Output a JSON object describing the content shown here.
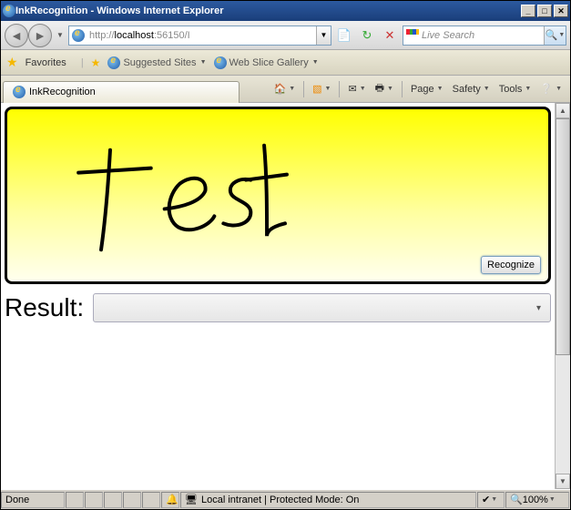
{
  "window": {
    "title": "InkRecognition - Windows Internet Explorer"
  },
  "address": {
    "prefix": "http://",
    "host": "localhost",
    "suffix": ":56150/I"
  },
  "search": {
    "placeholder": "Live Search"
  },
  "favorites": {
    "label": "Favorites",
    "suggested": "Suggested Sites",
    "webslice": "Web Slice Gallery"
  },
  "tab": {
    "title": "InkRecognition"
  },
  "commands": {
    "page": "Page",
    "safety": "Safety",
    "tools": "Tools"
  },
  "ink": {
    "recognize_label": "Recognize"
  },
  "result": {
    "label": "Result:",
    "value": ""
  },
  "status": {
    "done": "Done",
    "zone": "Local intranet | Protected Mode: On",
    "zoom": "100%"
  }
}
